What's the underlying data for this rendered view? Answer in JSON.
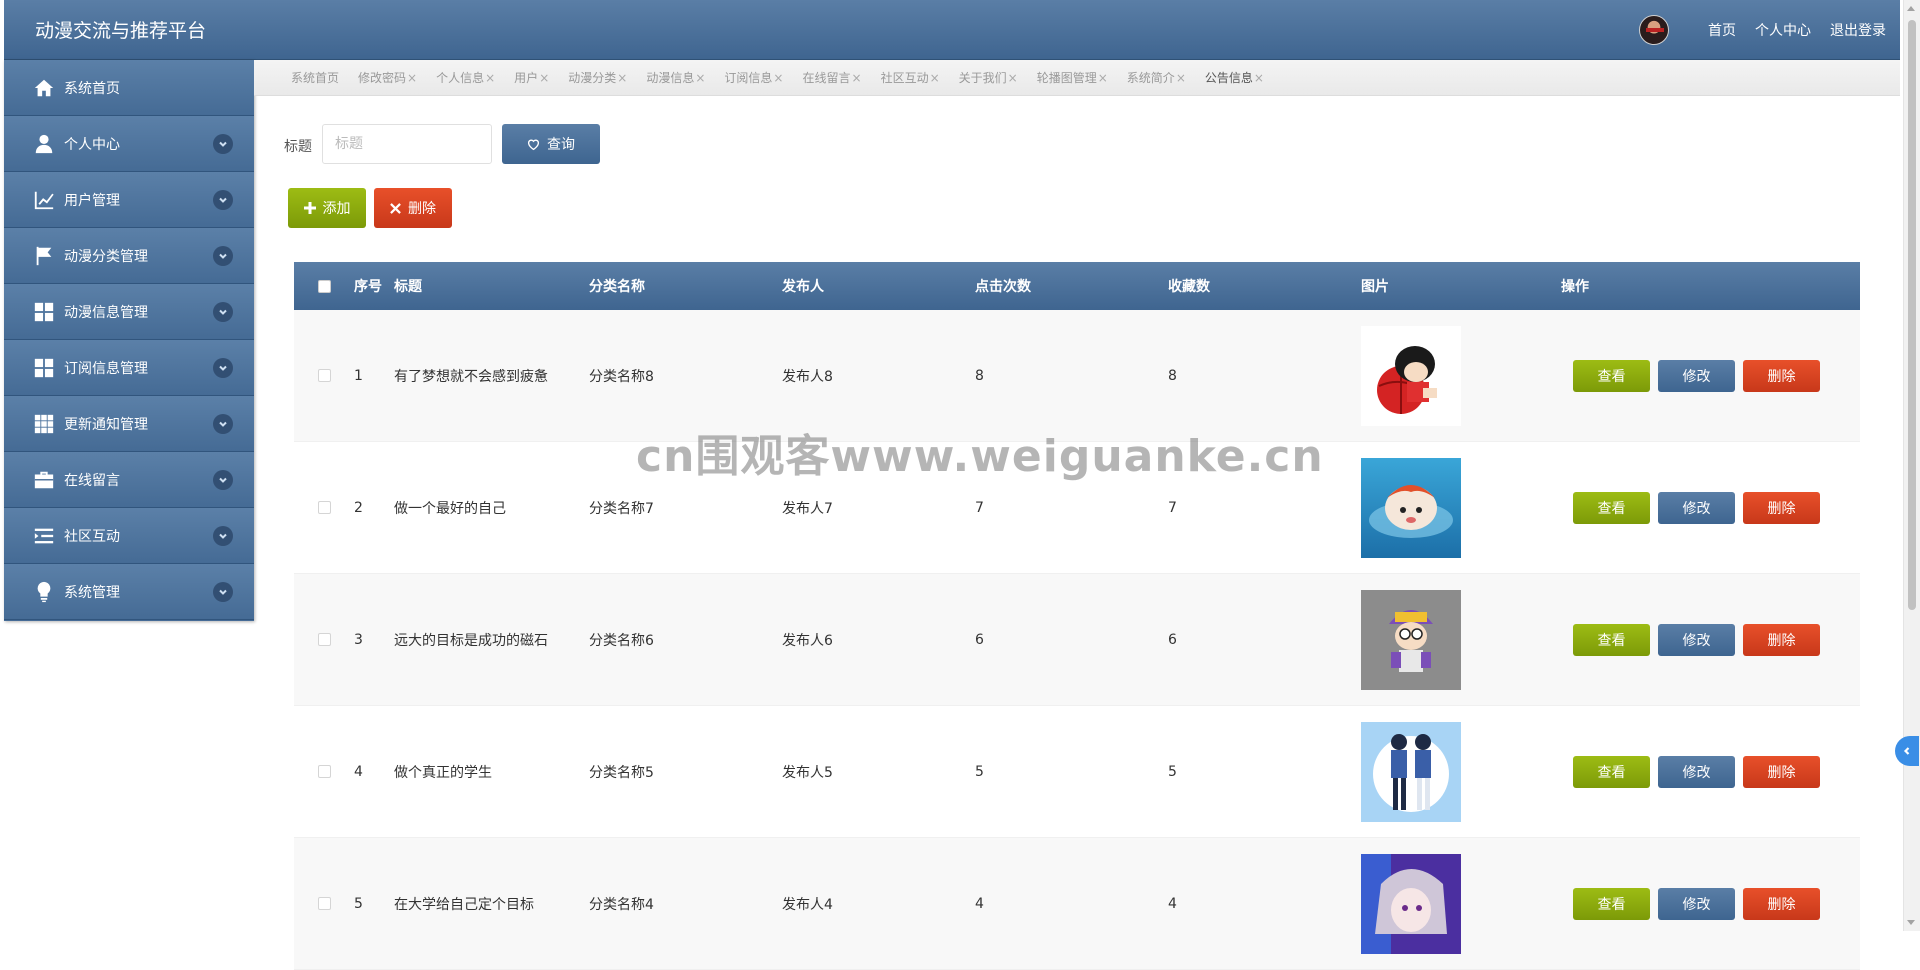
{
  "header": {
    "title": "动漫交流与推荐平台",
    "links": [
      "首页",
      "个人中心",
      "退出登录"
    ]
  },
  "sidebar": {
    "items": [
      {
        "label": "系统首页",
        "icon": "home-icon",
        "expandable": false
      },
      {
        "label": "个人中心",
        "icon": "user-icon",
        "expandable": true
      },
      {
        "label": "用户管理",
        "icon": "chart-icon",
        "expandable": true
      },
      {
        "label": "动漫分类管理",
        "icon": "flag-icon",
        "expandable": true
      },
      {
        "label": "动漫信息管理",
        "icon": "grid-icon",
        "expandable": true
      },
      {
        "label": "订阅信息管理",
        "icon": "grid-icon",
        "expandable": true
      },
      {
        "label": "更新通知管理",
        "icon": "apps-icon",
        "expandable": true
      },
      {
        "label": "在线留言",
        "icon": "briefcase-icon",
        "expandable": true
      },
      {
        "label": "社区互动",
        "icon": "list-indent-icon",
        "expandable": true
      },
      {
        "label": "系统管理",
        "icon": "bulb-icon",
        "expandable": true
      }
    ]
  },
  "tabs": [
    {
      "label": "系统首页",
      "closable": false
    },
    {
      "label": "修改密码",
      "closable": true
    },
    {
      "label": "个人信息",
      "closable": true
    },
    {
      "label": "用户",
      "closable": true
    },
    {
      "label": "动漫分类",
      "closable": true
    },
    {
      "label": "动漫信息",
      "closable": true
    },
    {
      "label": "订阅信息",
      "closable": true
    },
    {
      "label": "在线留言",
      "closable": true
    },
    {
      "label": "社区互动",
      "closable": true
    },
    {
      "label": "关于我们",
      "closable": true
    },
    {
      "label": "轮播图管理",
      "closable": true
    },
    {
      "label": "系统简介",
      "closable": true
    },
    {
      "label": "公告信息",
      "closable": true,
      "active": true
    }
  ],
  "tab_close_glyph": "×",
  "search": {
    "label": "标题",
    "placeholder": "标题",
    "value": "",
    "button": "查询"
  },
  "actions": {
    "add": "添加",
    "delete": "删除"
  },
  "table": {
    "columns": [
      "序号",
      "标题",
      "分类名称",
      "发布人",
      "点击次数",
      "收藏数",
      "图片",
      "操作"
    ],
    "row_actions": {
      "view": "查看",
      "edit": "修改",
      "delete": "删除"
    },
    "rows": [
      {
        "no": "1",
        "title": "有了梦想就不会感到疲惫",
        "category": "分类名称8",
        "publisher": "发布人8",
        "clicks": "8",
        "favorites": "8",
        "image": "anime-boy-basketball"
      },
      {
        "no": "2",
        "title": "做一个最好的自己",
        "category": "分类名称7",
        "publisher": "发布人7",
        "clicks": "7",
        "favorites": "7",
        "image": "ponyo-water"
      },
      {
        "no": "3",
        "title": "远大的目标是成功的磁石",
        "category": "分类名称6",
        "publisher": "发布人6",
        "clicks": "6",
        "favorites": "6",
        "image": "arale-girl"
      },
      {
        "no": "4",
        "title": "做个真正的学生",
        "category": "分类名称5",
        "publisher": "发布人5",
        "clicks": "5",
        "favorites": "5",
        "image": "anime-couple"
      },
      {
        "no": "5",
        "title": "在大学给自己定个目标",
        "category": "分类名称4",
        "publisher": "发布人4",
        "clicks": "4",
        "favorites": "4",
        "image": "anime-girl-purple"
      }
    ]
  },
  "watermark": "cn围观客www.weiguanke.cn",
  "colors": {
    "primary": "#4a709a",
    "success": "#8aaa0e",
    "danger": "#d6431f"
  }
}
